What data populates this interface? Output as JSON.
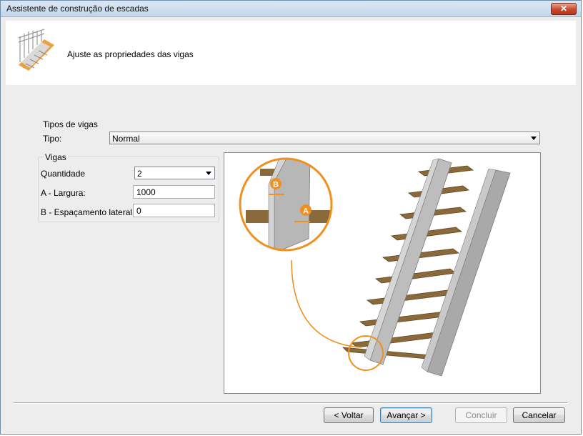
{
  "window": {
    "title": "Assistente de construção de escadas",
    "close_glyph": "✕"
  },
  "header": {
    "text": "Ajuste as propriedades das vigas",
    "icon": "stairs-icon"
  },
  "tipos": {
    "group_label": "Tipos de vigas",
    "tipo_label": "Tipo:",
    "tipo_value": "Normal"
  },
  "vigas": {
    "group_label": "Vigas",
    "quantidade_label": "Quantidade",
    "quantidade_value": "2",
    "largura_label": "A - Largura:",
    "largura_value": "1000",
    "espacamento_label": "B - Espaçamento lateral:",
    "espacamento_value": "0"
  },
  "preview": {
    "marker_a": "A",
    "marker_b": "B",
    "accent": "#f0901e",
    "wood": "#8a6a3a",
    "beam": "#b5b5b5"
  },
  "buttons": {
    "back": "< Voltar",
    "next": "Avançar >",
    "finish": "Concluir",
    "cancel": "Cancelar"
  }
}
